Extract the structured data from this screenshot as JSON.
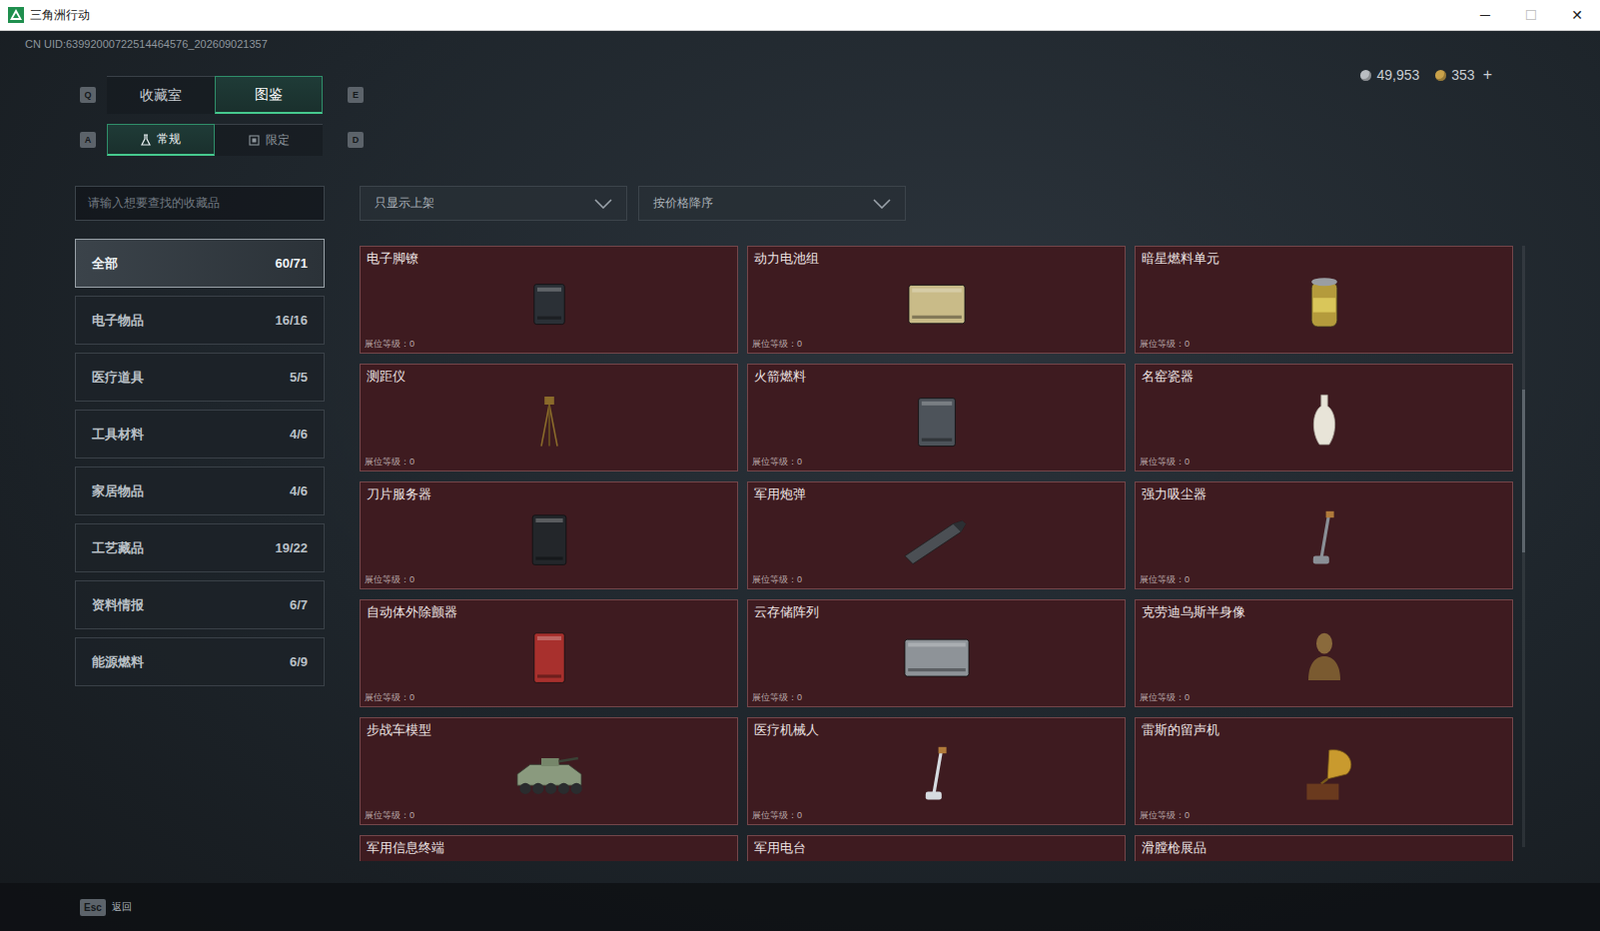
{
  "window": {
    "title": "三角洲行动",
    "controls": [
      {
        "label": "─",
        "disabled": false
      },
      {
        "label": "☐",
        "disabled": true
      },
      {
        "label": "✕",
        "disabled": false
      }
    ]
  },
  "uid": "CN UID:63992000722514464576_202609021357",
  "currency": [
    {
      "amount": "49,953",
      "color": "#b9bdc2"
    },
    {
      "amount": "353",
      "color": "#c9a24a"
    }
  ],
  "currency_add": "+",
  "tab_keys": [
    "Q",
    "E"
  ],
  "tabs": [
    {
      "label": "收藏室",
      "selected": false
    },
    {
      "label": "图鉴",
      "selected": true
    }
  ],
  "subtab_keys": [
    "A",
    "D"
  ],
  "subtabs": [
    {
      "label": "常规",
      "selected": true
    },
    {
      "label": "限定",
      "selected": false
    }
  ],
  "search": {
    "placeholder": "请输入想要查找的收藏品"
  },
  "filters": [
    {
      "label": "只显示上架"
    },
    {
      "label": "按价格降序"
    }
  ],
  "sidebar": {
    "items": [
      {
        "label": "全部",
        "count": "60/71",
        "selected": true
      },
      {
        "label": "电子物品",
        "count": "16/16",
        "selected": false
      },
      {
        "label": "医疗道具",
        "count": "5/5",
        "selected": false
      },
      {
        "label": "工具材料",
        "count": "4/6",
        "selected": false
      },
      {
        "label": "家居物品",
        "count": "4/6",
        "selected": false
      },
      {
        "label": "工艺藏品",
        "count": "19/22",
        "selected": false
      },
      {
        "label": "资料情报",
        "count": "6/7",
        "selected": false
      },
      {
        "label": "能源燃料",
        "count": "6/9",
        "selected": false
      }
    ]
  },
  "grid": {
    "items": [
      {
        "name": "电子脚镣",
        "booth": "展位等级：0"
      },
      {
        "name": "动力电池组",
        "booth": "展位等级：0"
      },
      {
        "name": "暗星燃料单元",
        "booth": "展位等级：0"
      },
      {
        "name": "测距仪",
        "booth": "展位等级：0"
      },
      {
        "name": "火箭燃料",
        "booth": "展位等级：0"
      },
      {
        "name": "名窑瓷器",
        "booth": "展位等级：0"
      },
      {
        "name": "刀片服务器",
        "booth": "展位等级：0"
      },
      {
        "name": "军用炮弹",
        "booth": "展位等级：0"
      },
      {
        "name": "强力吸尘器",
        "booth": "展位等级：0"
      },
      {
        "name": "自动体外除颤器",
        "booth": "展位等级：0"
      },
      {
        "name": "云存储阵列",
        "booth": "展位等级：0"
      },
      {
        "name": "克劳迪乌斯半身像",
        "booth": "展位等级：0"
      },
      {
        "name": "步战车模型",
        "booth": "展位等级：0"
      },
      {
        "name": "医疗机械人",
        "booth": "展位等级：0"
      },
      {
        "name": "雷斯的留声机",
        "booth": "展位等级：0"
      },
      {
        "name": "军用信息终端"
      },
      {
        "name": "军用电台"
      },
      {
        "name": "滑膛枪展品"
      }
    ]
  },
  "scrollbar": {
    "position": 0.24,
    "size": 0.27
  },
  "footer": {
    "key": "Esc",
    "label": "返回"
  }
}
